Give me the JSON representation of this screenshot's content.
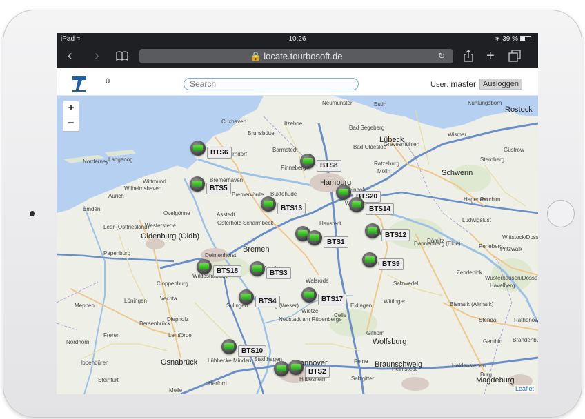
{
  "status_bar": {
    "carrier": "iPad",
    "time": "10:26",
    "battery": "39 %"
  },
  "browser": {
    "url": "locate.tourbosoft.de"
  },
  "app": {
    "counter": "0",
    "search_placeholder": "Search",
    "user_label": "User:",
    "user_name": "master",
    "logout_label": "Ausloggen"
  },
  "map": {
    "zoom_in": "+",
    "zoom_out": "−",
    "attribution": "Leaflet",
    "stations": [
      {
        "label": "BTS8"
      },
      {
        "label": "BTS6"
      },
      {
        "label": "BTS20"
      },
      {
        "label": "BTS13"
      },
      {
        "label": "BTS14"
      },
      {
        "label": "BTS5"
      },
      {
        "label": "BTS12"
      },
      {
        "label": "BTS1"
      },
      {
        "label": "BTS9"
      },
      {
        "label": "BTS18"
      },
      {
        "label": "BTS3"
      },
      {
        "label": "BTS17"
      },
      {
        "label": "BTS4"
      },
      {
        "label": "BTS10"
      },
      {
        "label": "BTS2"
      }
    ],
    "cities": [
      {
        "name": "Neumünster"
      },
      {
        "name": "Eutin"
      },
      {
        "name": "Kühlungsborn"
      },
      {
        "name": "Rostock"
      },
      {
        "name": "Cuxhaven"
      },
      {
        "name": "Itzehoe"
      },
      {
        "name": "Bad Segeberg"
      },
      {
        "name": "Lübeck"
      },
      {
        "name": "Wismar"
      },
      {
        "name": "Grevesmühlen"
      },
      {
        "name": "Güstrow"
      },
      {
        "name": "Brunsbüttel"
      },
      {
        "name": "Barmstedt"
      },
      {
        "name": "Bad Oldesloe"
      },
      {
        "name": "Norderney"
      },
      {
        "name": "Langeoog"
      },
      {
        "name": "Otterndorf"
      },
      {
        "name": "Pinneberg"
      },
      {
        "name": "Ratzeburg"
      },
      {
        "name": "Mölln"
      },
      {
        "name": "Schwerin"
      },
      {
        "name": "Sternberg"
      },
      {
        "name": "Wittmund"
      },
      {
        "name": "Bremerhaven"
      },
      {
        "name": "Hamburg"
      },
      {
        "name": "Wilhelmshaven"
      },
      {
        "name": "Aurich"
      },
      {
        "name": "Buxtehude"
      },
      {
        "name": "Bremervörde"
      },
      {
        "name": "Reinbek"
      },
      {
        "name": "Parchim"
      },
      {
        "name": "Hagenow"
      },
      {
        "name": "Emden"
      },
      {
        "name": "Ovelgönne"
      },
      {
        "name": "Winsen"
      },
      {
        "name": "Ludwigslust"
      },
      {
        "name": "Asstedt"
      },
      {
        "name": "Westerstede"
      },
      {
        "name": "Leer (Ostfriesland)"
      },
      {
        "name": "Osterholz-Scharmbeck"
      },
      {
        "name": "Hanstedt"
      },
      {
        "name": "Lüneburg"
      },
      {
        "name": "Dömitz"
      },
      {
        "name": "Wittstock/Dosse"
      },
      {
        "name": "Oldenburg (Oldb)"
      },
      {
        "name": "Bremen"
      },
      {
        "name": "Dannenberg (Elbe)"
      },
      {
        "name": "Perleberg"
      },
      {
        "name": "Papenburg"
      },
      {
        "name": "Delmenhorst"
      },
      {
        "name": "Verden"
      },
      {
        "name": "Uelzen"
      },
      {
        "name": "Pritzwalk"
      },
      {
        "name": "Cloppenburg"
      },
      {
        "name": "Wildeshausen"
      },
      {
        "name": "Walsrode"
      },
      {
        "name": "Salzwedel"
      },
      {
        "name": "Zehdenick"
      },
      {
        "name": "Wusterhausen/Dosse"
      },
      {
        "name": "Havelberg"
      },
      {
        "name": "Meppen"
      },
      {
        "name": "Löningen"
      },
      {
        "name": "Vechta"
      },
      {
        "name": "Sulingen"
      },
      {
        "name": "Nienburg (Weser)"
      },
      {
        "name": "Wietze"
      },
      {
        "name": "Celle"
      },
      {
        "name": "Eldingen"
      },
      {
        "name": "Wittingen"
      },
      {
        "name": "Bismark (Altmark)"
      },
      {
        "name": "Stendal"
      },
      {
        "name": "Rathenow"
      },
      {
        "name": "Diepholz"
      },
      {
        "name": "Bersenbrück"
      },
      {
        "name": "Neustadt am Rübenberge"
      },
      {
        "name": "Gifhorn"
      },
      {
        "name": "Nordhorn"
      },
      {
        "name": "Freren"
      },
      {
        "name": "Lemförde"
      },
      {
        "name": "Wolfsburg"
      },
      {
        "name": "Genthin"
      },
      {
        "name": "Brandenburg an der Havel"
      },
      {
        "name": "Ibbenbüren"
      },
      {
        "name": "Osnabrück"
      },
      {
        "name": "Lübbecke"
      },
      {
        "name": "Minden"
      },
      {
        "name": "Stadthagen"
      },
      {
        "name": "Hannover"
      },
      {
        "name": "Peine"
      },
      {
        "name": "Braunschweig"
      },
      {
        "name": "Helmstedt"
      },
      {
        "name": "Haldensleben"
      },
      {
        "name": "Burg"
      },
      {
        "name": "Steinfurt"
      },
      {
        "name": "Melle"
      },
      {
        "name": "Herford"
      },
      {
        "name": "Hildesheim"
      },
      {
        "name": "Salzgitter"
      },
      {
        "name": "Magdeburg"
      }
    ]
  }
}
